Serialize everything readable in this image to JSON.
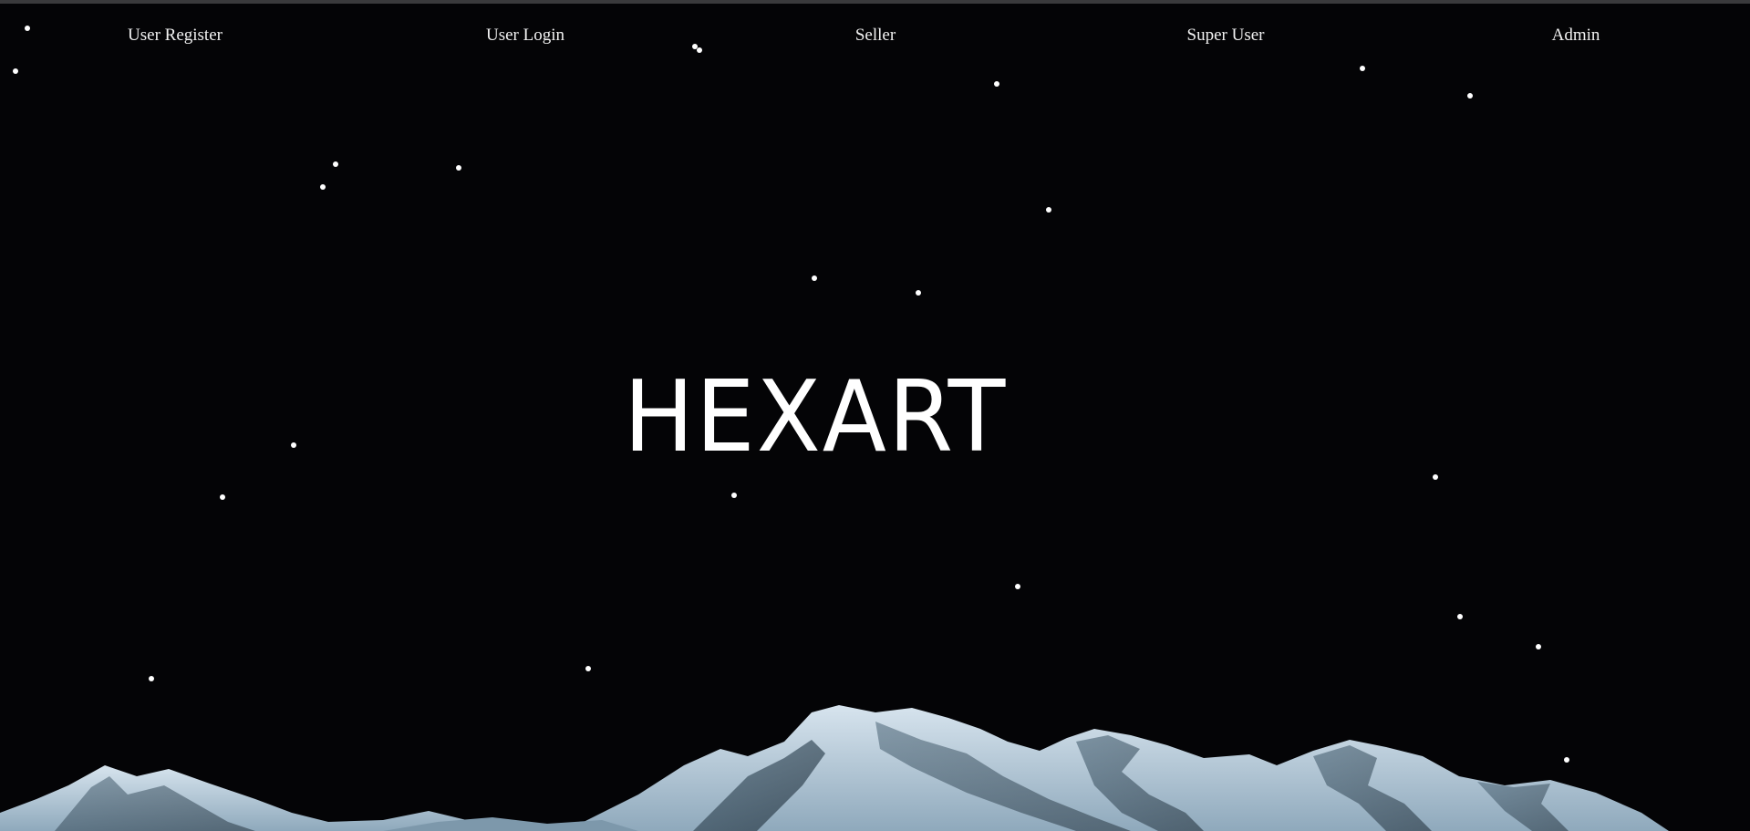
{
  "nav": {
    "items": [
      {
        "label": "User Register"
      },
      {
        "label": "User Login"
      },
      {
        "label": "Seller"
      },
      {
        "label": "Super User"
      },
      {
        "label": "Admin"
      }
    ]
  },
  "hero": {
    "title": "HEXART"
  },
  "colors": {
    "background": "#040406",
    "text": "#ffffff",
    "mountain_snow": "#b9cfdf",
    "mountain_shadow": "#3d5566"
  }
}
